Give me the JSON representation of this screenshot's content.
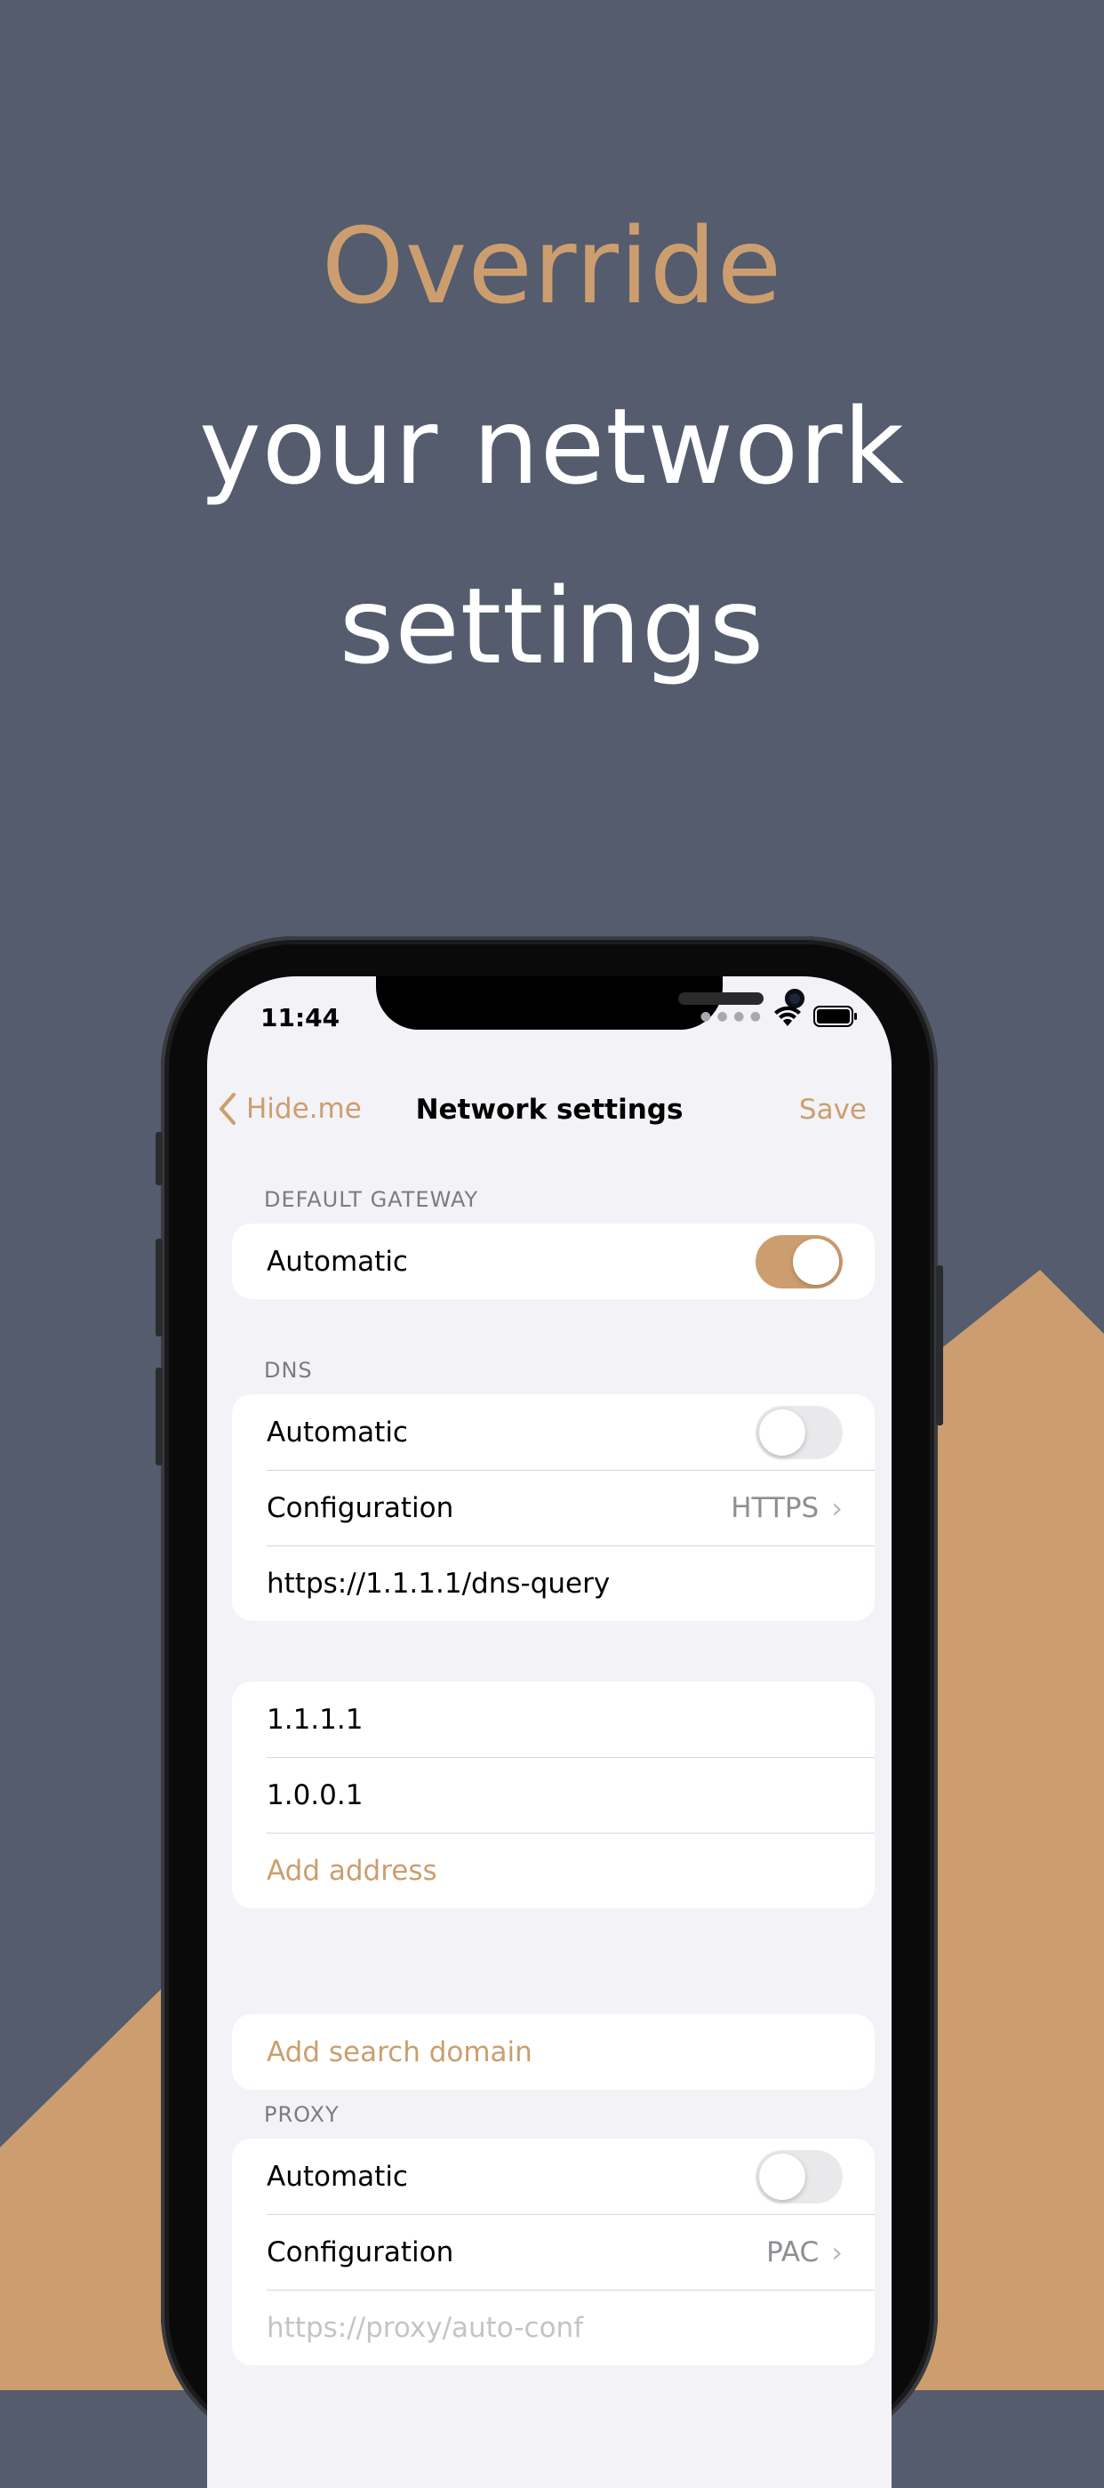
{
  "headline": {
    "line1": "Override",
    "line2": "your network",
    "line3": "settings"
  },
  "colors": {
    "background": "#545c6e",
    "accent": "#cc9e6f",
    "phone_screen": "#f2f2f7"
  },
  "status_bar": {
    "time": "11:44",
    "icons": [
      "signal-dots-icon",
      "wifi-icon",
      "battery-icon"
    ]
  },
  "navbar": {
    "back_label": "Hide.me",
    "title": "Network settings",
    "save_label": "Save"
  },
  "default_gateway": {
    "header": "DEFAULT GATEWAY",
    "automatic_label": "Automatic",
    "automatic_on": true
  },
  "dns": {
    "header": "DNS",
    "automatic_label": "Automatic",
    "automatic_on": false,
    "configuration_label": "Configuration",
    "configuration_value": "HTTPS",
    "url": "https://1.1.1.1/dns-query",
    "addresses": [
      "1.1.1.1",
      "1.0.0.1"
    ],
    "add_address_label": "Add address",
    "add_search_domain_label": "Add search domain"
  },
  "proxy": {
    "header": "PROXY",
    "automatic_label": "Automatic",
    "automatic_on": false,
    "configuration_label": "Configuration",
    "configuration_value": "PAC",
    "url_placeholder": "https://proxy/auto-conf"
  }
}
